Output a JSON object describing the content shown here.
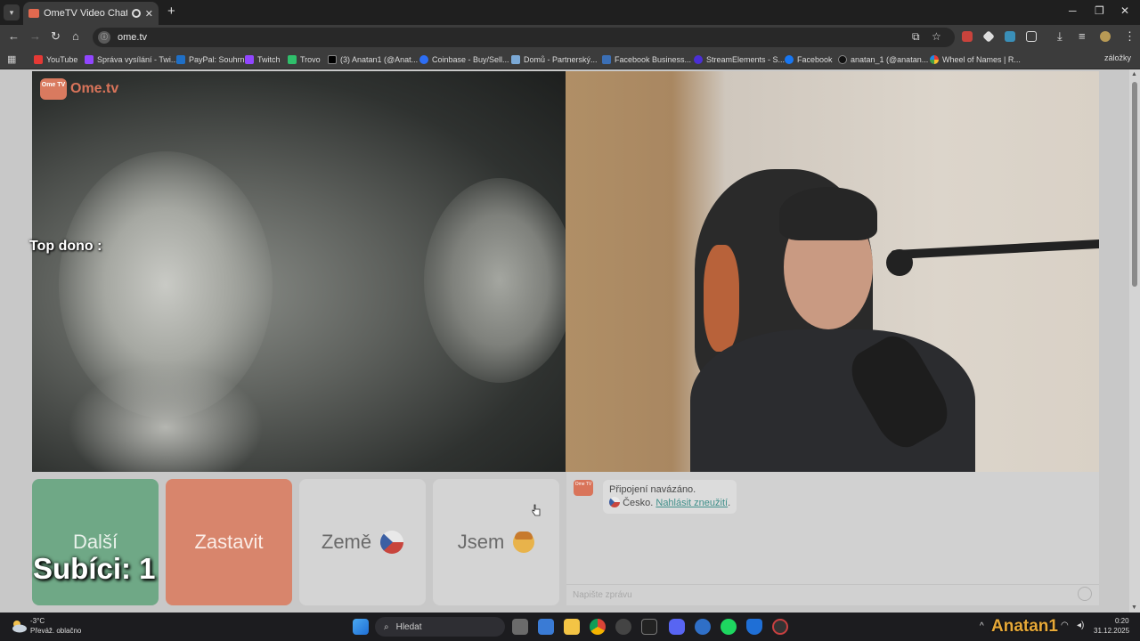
{
  "browser": {
    "tab_title": "OmeTV Video Chat — Ome...",
    "url": "ome.tv",
    "bookmarks": [
      "YouTube",
      "Správa vysílání - Twi...",
      "PayPal: Souhrn",
      "Twitch",
      "Trovo",
      "(3) Anatan1 (@Anat...",
      "Coinbase - Buy/Sell...",
      "Domů - Partnerský...",
      "Facebook Business...",
      "StreamElements - S...",
      "Facebook",
      "anatan_1 (@anatan...",
      "Wheel of Names | R..."
    ],
    "more_bookmarks": "záložky"
  },
  "page": {
    "logo_text": "Ome.tv",
    "logo_badge": "Ome TV",
    "overlay_top_dono": "Top dono :",
    "overlay_subs": "Subíci: 1",
    "buttons": {
      "next": "Další",
      "stop": "Zastavit",
      "country": "Země",
      "iam": "Jsem"
    },
    "chat": {
      "connected": "Připojení navázáno.",
      "country": "Česko.",
      "report": "Nahlásit zneužití",
      "report_suffix": ".",
      "placeholder": "Napište zprávu"
    }
  },
  "taskbar": {
    "weather_temp": "-3°C",
    "weather_desc": "Převáž. oblačno",
    "search_placeholder": "Hledat",
    "time": "0:20",
    "date": "31.12.2025",
    "overlay_name": "Anatan1"
  }
}
